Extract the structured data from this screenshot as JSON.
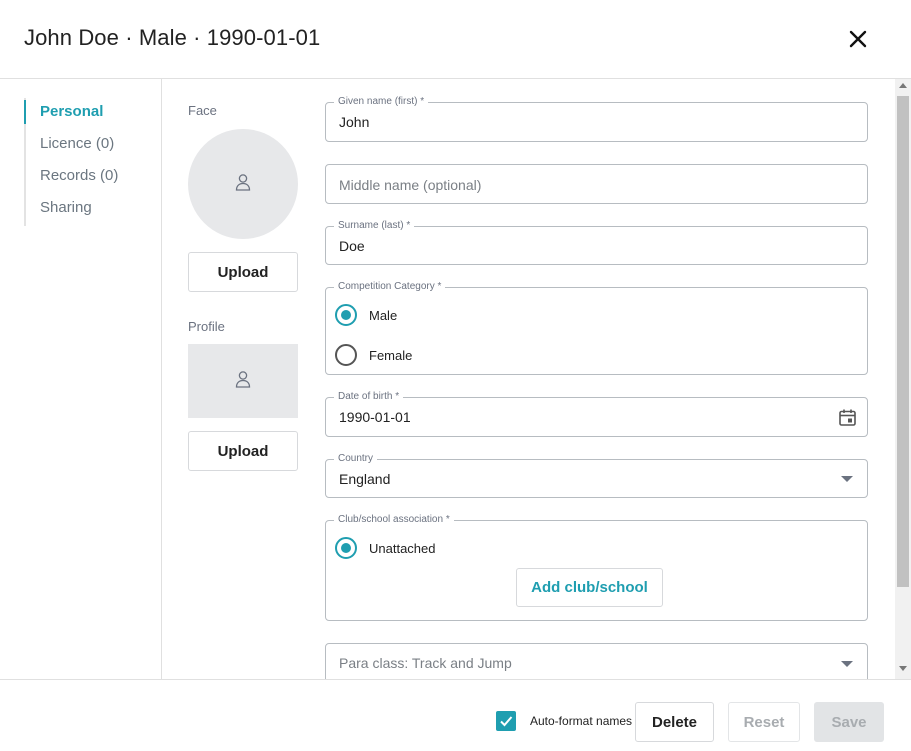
{
  "header": {
    "title": "John Doe · Male · 1990-01-01",
    "close_icon": "close-icon"
  },
  "nav": {
    "items": [
      {
        "label": "Personal",
        "active": true
      },
      {
        "label": "Licence (0)",
        "active": false
      },
      {
        "label": "Records (0)",
        "active": false
      },
      {
        "label": "Sharing",
        "active": false
      }
    ]
  },
  "photos": {
    "face_label": "Face",
    "profile_label": "Profile",
    "upload_label": "Upload",
    "placeholder_icon": "person-icon"
  },
  "form": {
    "given_name": {
      "legend": "Given name (first) *",
      "value": "John"
    },
    "middle_name": {
      "placeholder": "Middle name (optional)"
    },
    "surname": {
      "legend": "Surname (last) *",
      "value": "Doe"
    },
    "category": {
      "legend": "Competition Category  *",
      "options": [
        {
          "label": "Male",
          "selected": true
        },
        {
          "label": "Female",
          "selected": false
        }
      ]
    },
    "dob": {
      "legend": "Date of birth *",
      "value": "1990-01-01",
      "icon": "calendar-icon"
    },
    "country": {
      "legend": "Country",
      "value": "England"
    },
    "club": {
      "legend": "Club/school association *",
      "option_label": "Unattached",
      "add_label": "Add club/school"
    },
    "para_class": {
      "placeholder": "Para class: Track and Jump"
    }
  },
  "footer": {
    "autoformat_label": "Auto-format names",
    "autoformat_checked": true,
    "delete_label": "Delete",
    "reset_label": "Reset",
    "save_label": "Save"
  },
  "colors": {
    "accent": "#1f9eb0",
    "border": "#b7bcc1",
    "muted": "#6b7280"
  }
}
